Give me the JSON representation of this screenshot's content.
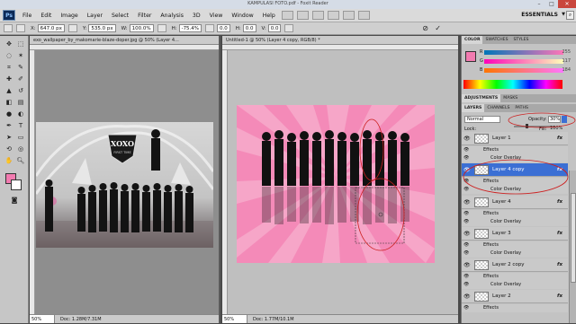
{
  "window": {
    "title": "KAMPULASI FOTO.pdf - Foxit Reader"
  },
  "menubar": {
    "logo": "Ps",
    "items": [
      "File",
      "Edit",
      "Image",
      "Layer",
      "Select",
      "Filter",
      "Analysis",
      "3D",
      "View",
      "Window",
      "Help"
    ],
    "workspace": "ESSENTIALS"
  },
  "options": {
    "x_label": "X:",
    "x_value": "647.0 px",
    "y_label": "Y:",
    "y_value": "535.0 px",
    "w_label": "W:",
    "w_value": "100.0%",
    "h_label": "H:",
    "h_value": "-75.4%",
    "angle_value": "0.0",
    "h_skew_label": "H:",
    "h_skew_value": "0.0",
    "v_skew_label": "V:",
    "v_skew_value": "0.0"
  },
  "doc1": {
    "tab": "exo_wallpaper_by_makomarie-blaze-doper.jpg @ 50% (Layer 4...",
    "zoom": "50%",
    "docsize": "Doc: 1.28M/7.31M",
    "logo_main": "XOXO",
    "logo_sub": "FIRST TIME"
  },
  "doc2": {
    "tab": "Untitled-1 @ 50% (Layer 4 copy, RGB/8) *",
    "zoom": "50%",
    "docsize": "Doc: 1.77M/10.1M"
  },
  "color_panel": {
    "tabs": [
      "COLOR",
      "SWATCHES",
      "STYLES"
    ],
    "r_label": "R",
    "r_value": "255",
    "g_label": "G",
    "g_value": "117",
    "b_label": "B",
    "b_value": "184"
  },
  "adjustments_panel": {
    "tabs": [
      "ADJUSTMENTS",
      "MASKS"
    ]
  },
  "layers_panel": {
    "tabs": [
      "LAYERS",
      "CHANNELS",
      "PATHS"
    ],
    "blend_mode": "Normal",
    "opacity_label": "Opacity:",
    "opacity_value": "30%",
    "lock_label": "Lock:",
    "fill_label": "Fill:",
    "fill_value": "100%",
    "effects_label": "Effects",
    "color_overlay_label": "Color Overlay",
    "layers": [
      {
        "name": "Layer 1",
        "fx": "fx",
        "selected": false
      },
      {
        "name": "Layer 4 copy",
        "fx": "fx",
        "selected": true
      },
      {
        "name": "Layer 4",
        "fx": "fx",
        "selected": false
      },
      {
        "name": "Layer 3",
        "fx": "fx",
        "selected": false
      },
      {
        "name": "Layer 2 copy",
        "fx": "fx",
        "selected": false
      },
      {
        "name": "Layer 2",
        "fx": "fx",
        "selected": false
      }
    ]
  },
  "colors": {
    "foreground": "#f27bb0",
    "background": "#ffffff",
    "canvas_pink": "#f48ab8",
    "ray_pink": "#f6a6c8",
    "selection": "#3b6fd4",
    "annotation": "#cc1f1f"
  }
}
